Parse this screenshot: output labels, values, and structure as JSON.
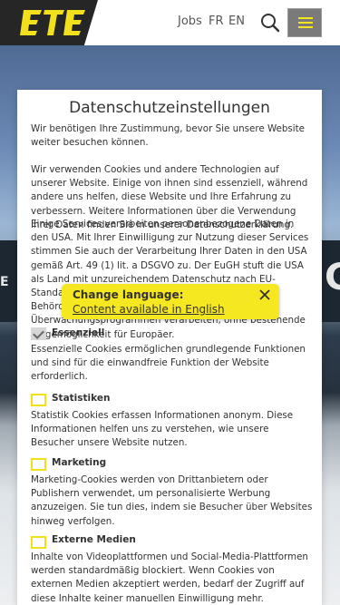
{
  "header": {
    "nav": {
      "jobs": "Jobs",
      "fr": "FR",
      "en": "EN"
    },
    "logo_name": "ETE logo",
    "accent_color": "#f2e01d",
    "icons": {
      "search": "search-icon",
      "menu": "hamburger-menu-icon"
    }
  },
  "hero": {
    "sign_left": "E N",
    "sign_right": "G"
  },
  "modal": {
    "title": "Datenschutzeinstellungen",
    "intro": "Wir benötigen Ihre Zustimmung, bevor Sie unsere Website weiter besuchen können.",
    "cookies_info": "Wir verwenden Cookies und andere Technologien auf unserer Website. Einige von ihnen sind essenziell, während andere uns helfen, diese Website und Ihre Erfahrung zu verbessern. Weitere Informationen über die Verwendung Ihrer Daten finden Sie in unserer Datenschutzerklärung.",
    "usa_info": "Einige Services verarbeiten personenbezogene Daten in den USA. Mit Ihrer Einwilligung zur Nutzung dieser Services stimmen Sie auch der Verarbeitung Ihrer Daten in den USA gemäß Art. 49 (1) lit. a DSGVO zu. Der EuGH stuft die USA als Land mit unzureichendem Datenschutz nach EU-Standards ein. So besteht etwa das Risiko, dass US-Behörden personenbezogene Daten in Überwachungsprogrammen verarbeiten, ohne bestehende Klagemöglichkeit für Europäer.",
    "categories": [
      {
        "label": "Essenziell",
        "checked": true,
        "description": "Essenzielle Cookies ermöglichen grundlegende Funktionen und sind für die einwandfreie Funktion der Website erforderlich."
      },
      {
        "label": "Statistiken",
        "checked": false,
        "description": "Statistik Cookies erfassen Informationen anonym. Diese Informationen helfen uns zu verstehen, wie unsere Besucher unsere Website nutzen."
      },
      {
        "label": "Marketing",
        "checked": false,
        "description": "Marketing-Cookies werden von Drittanbietern oder Publishern verwendet, um personalisierte Werbung anzuzeigen. Sie tun dies, indem sie Besucher über Websites hinweg verfolgen."
      },
      {
        "label": "Externe Medien",
        "checked": false,
        "description": "Inhalte von Videoplattformen und Social-Media-Plattformen werden standardmäßig blockiert. Wenn Cookies von externen Medien akzeptiert werden, bedarf der Zugriff auf diese Inhalte keiner manuellen Einwilligung mehr."
      }
    ]
  },
  "language_popup": {
    "title": "Change language:",
    "link": "Content available in English",
    "background": "#f5e720",
    "close_icon": "close-icon"
  }
}
